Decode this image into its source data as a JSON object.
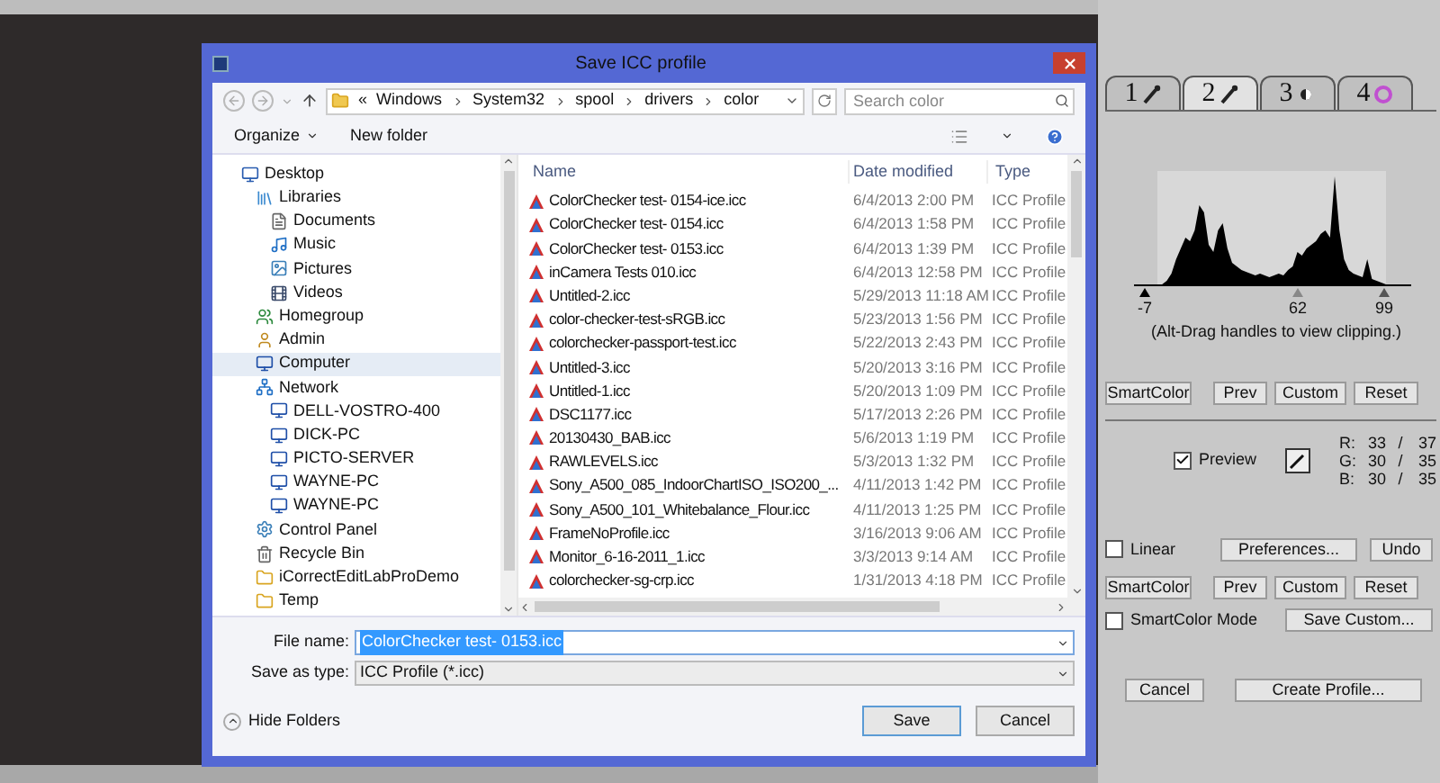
{
  "dialog": {
    "title": "Save ICC profile",
    "nav": {
      "overflow": "«",
      "path": [
        "Windows",
        "System32",
        "spool",
        "drivers",
        "color"
      ],
      "search_placeholder": "Search color"
    },
    "toolbar": {
      "organize": "Organize",
      "new_folder": "New folder"
    },
    "tree": [
      {
        "label": "Desktop",
        "kind": "desktop",
        "selected": false,
        "children": [
          {
            "label": "Libraries",
            "kind": "library",
            "selected": false,
            "children": [
              {
                "label": "Documents",
                "kind": "document",
                "selected": false
              },
              {
                "label": "Music",
                "kind": "music",
                "selected": false
              },
              {
                "label": "Pictures",
                "kind": "pictures",
                "selected": false
              },
              {
                "label": "Videos",
                "kind": "videos",
                "selected": false
              }
            ]
          },
          {
            "label": "Homegroup",
            "kind": "homegroup",
            "selected": false
          },
          {
            "label": "Admin",
            "kind": "user",
            "selected": false
          },
          {
            "label": "Computer",
            "kind": "computer",
            "selected": true
          },
          {
            "label": "Network",
            "kind": "network",
            "selected": false,
            "children": [
              {
                "label": "DELL-VOSTRO-400",
                "kind": "computer",
                "selected": false
              },
              {
                "label": "DICK-PC",
                "kind": "computer",
                "selected": false
              },
              {
                "label": "PICTO-SERVER",
                "kind": "computer",
                "selected": false
              },
              {
                "label": "WAYNE-PC",
                "kind": "computer",
                "selected": false
              },
              {
                "label": "WAYNE-PC",
                "kind": "computer",
                "selected": false
              }
            ]
          },
          {
            "label": "Control Panel",
            "kind": "control",
            "selected": false
          },
          {
            "label": "Recycle Bin",
            "kind": "recycle",
            "selected": false
          },
          {
            "label": "iCorrectEditLabProDemo",
            "kind": "folder",
            "selected": false
          },
          {
            "label": "Temp",
            "kind": "folder",
            "selected": false
          }
        ]
      }
    ],
    "columns": [
      "Name",
      "Date modified",
      "Type"
    ],
    "rows": [
      {
        "name": "ColorChecker test- 0154-ice.icc",
        "date": "6/4/2013 2:00 PM",
        "type": "ICC Profile"
      },
      {
        "name": "ColorChecker test- 0154.icc",
        "date": "6/4/2013 1:58 PM",
        "type": "ICC Profile"
      },
      {
        "name": "ColorChecker test- 0153.icc",
        "date": "6/4/2013 1:39 PM",
        "type": "ICC Profile"
      },
      {
        "name": "inCamera Tests 010.icc",
        "date": "6/4/2013 12:58 PM",
        "type": "ICC Profile"
      },
      {
        "name": "Untitled-2.icc",
        "date": "5/29/2013 11:18 AM",
        "type": "ICC Profile"
      },
      {
        "name": "color-checker-test-sRGB.icc",
        "date": "5/23/2013 1:56 PM",
        "type": "ICC Profile"
      },
      {
        "name": "colorchecker-passport-test.icc",
        "date": "5/22/2013 2:43 PM",
        "type": "ICC Profile"
      },
      {
        "name": "Untitled-3.icc",
        "date": "5/20/2013 3:16 PM",
        "type": "ICC Profile"
      },
      {
        "name": "Untitled-1.icc",
        "date": "5/20/2013 1:09 PM",
        "type": "ICC Profile"
      },
      {
        "name": "DSC1177.icc",
        "date": "5/17/2013 2:26 PM",
        "type": "ICC Profile"
      },
      {
        "name": "20130430_BAB.icc",
        "date": "5/6/2013 1:19 PM",
        "type": "ICC Profile"
      },
      {
        "name": "RAWLEVELS.icc",
        "date": "5/3/2013 1:32 PM",
        "type": "ICC Profile"
      },
      {
        "name": "Sony_A500_085_IndoorChartISO_ISO200_...",
        "date": "4/11/2013 1:42 PM",
        "type": "ICC Profile"
      },
      {
        "name": "Sony_A500_101_Whitebalance_Flour.icc",
        "date": "4/11/2013 1:25 PM",
        "type": "ICC Profile"
      },
      {
        "name": "FrameNoProfile.icc",
        "date": "3/16/2013 9:06 AM",
        "type": "ICC Profile"
      },
      {
        "name": "Monitor_6-16-2011_1.icc",
        "date": "3/3/2013 9:14 AM",
        "type": "ICC Profile"
      },
      {
        "name": "colorchecker-sg-crp.icc",
        "date": "1/31/2013 4:18 PM",
        "type": "ICC Profile"
      }
    ],
    "file_name": {
      "label": "File name:",
      "value": "ColorChecker test- 0153.icc"
    },
    "save_type": {
      "label": "Save as type:",
      "value": "ICC Profile (*.icc)"
    },
    "hide_folders": "Hide Folders",
    "save": "Save",
    "cancel": "Cancel"
  },
  "panel": {
    "tabs": [
      {
        "label": "1",
        "selected": false
      },
      {
        "label": "2",
        "selected": true
      },
      {
        "label": "3",
        "selected": false
      },
      {
        "label": "4",
        "selected": false
      }
    ],
    "histogram_ticks": [
      "-7",
      "62",
      "99"
    ],
    "caption": "(Alt-Drag handles to view clipping.)",
    "buttons_top": [
      "SmartColor",
      "Prev",
      "Custom",
      "Reset"
    ],
    "preview": {
      "label": "Preview",
      "checked": true
    },
    "readouts": [
      {
        "label": "R:",
        "value_1": "33",
        "separator": "/",
        "value_2": "37"
      },
      {
        "label": "G:",
        "value_1": "30",
        "separator": "/",
        "value_2": "35"
      },
      {
        "label": "B:",
        "value_1": "30",
        "separator": "/",
        "value_2": "35"
      }
    ],
    "linear": {
      "label": "Linear",
      "checked": false
    },
    "preferences": "Preferences...",
    "undo": "Undo",
    "buttons_bottom": [
      "SmartColor",
      "Prev",
      "Custom",
      "Reset"
    ],
    "smartcolor_mode": {
      "label": "SmartColor Mode",
      "checked": false
    },
    "save_custom": "Save Custom...",
    "cancel": "Cancel",
    "create_profile": "Create Profile..."
  }
}
